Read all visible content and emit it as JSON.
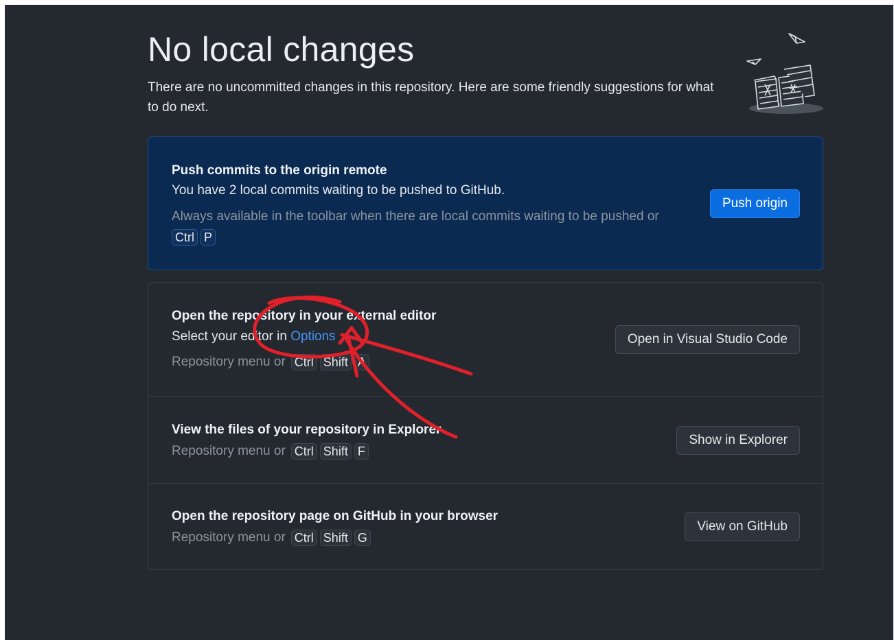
{
  "header": {
    "title": "No local changes",
    "subtitle": "There are no uncommitted changes in this repository. Here are some friendly suggestions for what to do next."
  },
  "push_card": {
    "title": "Push commits to the origin remote",
    "description": "You have 2 local commits waiting to be pushed to GitHub.",
    "hint": "Always available in the toolbar when there are local commits waiting to be pushed or",
    "shortcut": [
      "Ctrl",
      "P"
    ],
    "button_label": "Push origin"
  },
  "actions": [
    {
      "title": "Open the repository in your external editor",
      "description_prefix": "Select your editor in ",
      "description_link": "Options",
      "hint_prefix": "Repository menu or",
      "shortcut": [
        "Ctrl",
        "Shift",
        "A"
      ],
      "button_label": "Open in Visual Studio Code"
    },
    {
      "title": "View the files of your repository in Explorer",
      "hint_prefix": "Repository menu or",
      "shortcut": [
        "Ctrl",
        "Shift",
        "F"
      ],
      "button_label": "Show in Explorer"
    },
    {
      "title": "Open the repository page on GitHub in your browser",
      "hint_prefix": "Repository menu or",
      "shortcut": [
        "Ctrl",
        "Shift",
        "G"
      ],
      "button_label": "View on GitHub"
    }
  ],
  "colors": {
    "background": "#24292f",
    "push_card_bg": "#0b2a52",
    "primary_button": "#0b6ee0",
    "link": "#4493f8",
    "annotation_ink": "#e0202a"
  },
  "icons": [
    "empty-state-illustration",
    "red-scribble-annotation"
  ]
}
